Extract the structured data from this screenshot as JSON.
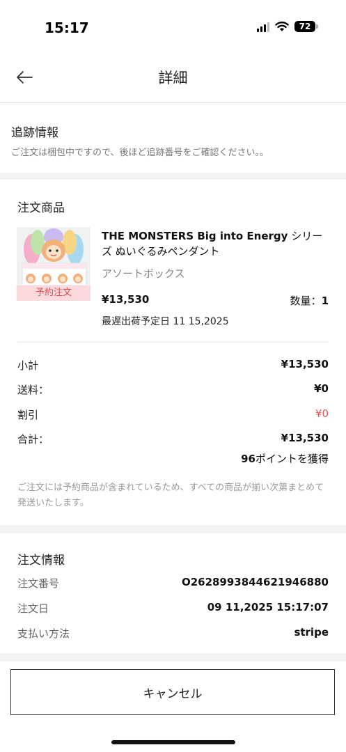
{
  "status_bar": {
    "time": "15:17",
    "battery": "72"
  },
  "header": {
    "title": "詳細"
  },
  "tracking": {
    "title": "追跡情報",
    "message": "ご注文は梱包中ですので、後ほど追跡番号をご確認ください。。"
  },
  "items": {
    "title": "注文商品",
    "product": {
      "name_en": "THE MONSTERS Big into Energy",
      "name_jp": " シリーズ ぬいぐるみペンダント",
      "variant": "アソートボックス",
      "price": "¥13,530",
      "qty_label": "数量：",
      "qty_value": "1",
      "ship_date": "最遅出荷予定日 11 15,2025",
      "preorder_tag": "予約注文"
    },
    "summary": [
      {
        "label": "小計",
        "value": "¥13,530"
      },
      {
        "label": "送料：",
        "value": "¥0"
      },
      {
        "label": "割引",
        "value": "¥0"
      },
      {
        "label": "合計：",
        "value": "¥13,530"
      }
    ],
    "points_value": "96",
    "points_label": "ポイントを獲得",
    "notice": "ご注文には予約商品が含まれているため、すべての商品が揃い次第まとめて発送いたします。"
  },
  "order_info": {
    "title": "注文情報",
    "rows": [
      {
        "label": "注文番号",
        "value": "O2628993844621946880"
      },
      {
        "label": "注文日",
        "value": "09 11,2025 15:17:07"
      },
      {
        "label": "支払い方法",
        "value": "stripe"
      }
    ]
  },
  "actions": {
    "cancel_label": "キャンセル"
  },
  "colors": {
    "discount_red": "#e25656",
    "preorder_bg": "#fadadd",
    "preorder_text": "#e04a4a"
  }
}
